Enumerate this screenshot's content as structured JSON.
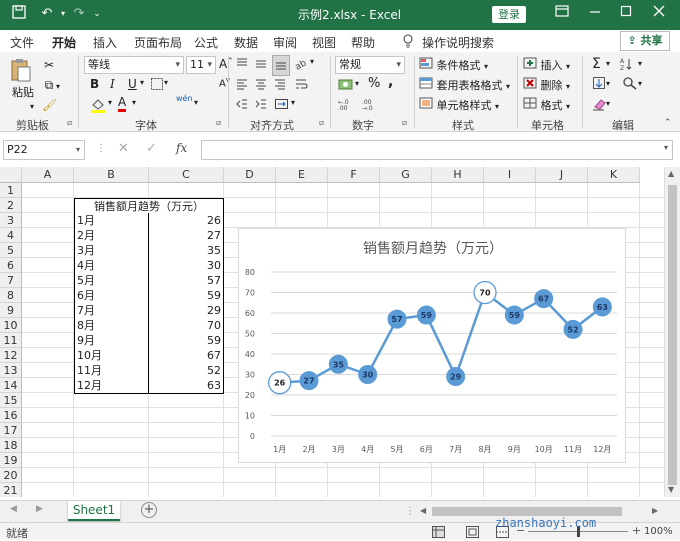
{
  "titlebar": {
    "filename": "示例2.xlsx",
    "sep": "-",
    "app": "Excel",
    "login": "登录",
    "undo": "↶",
    "redo": "↷"
  },
  "tabs": [
    "文件",
    "开始",
    "插入",
    "页面布局",
    "公式",
    "数据",
    "审阅",
    "视图",
    "帮助"
  ],
  "active_tab": "开始",
  "tell_me": "操作说明搜索",
  "share": "共享",
  "ribbon": {
    "clipboard": {
      "paste": "粘贴",
      "label": "剪贴板"
    },
    "font": {
      "name": "等线",
      "size": "11",
      "label": "字体",
      "bold": "B",
      "italic": "I",
      "underline": "U",
      "fontcolor": "A",
      "incA": "A",
      "decA": "A",
      "wen": "wén"
    },
    "alignment": {
      "label": "对齐方式"
    },
    "number": {
      "format": "常规",
      "label": "数字",
      "percent": "%",
      "comma": ","
    },
    "styles": {
      "cond": "条件格式",
      "table": "套用表格格式",
      "cell": "单元格样式",
      "label": "样式"
    },
    "cells": {
      "insert": "插入",
      "delete": "删除",
      "format": "格式",
      "label": "单元格"
    },
    "editing": {
      "label": "编辑",
      "sum": "Σ"
    }
  },
  "formula_bar": {
    "namebox": "P22",
    "fx": "fx",
    "value": ""
  },
  "columns": [
    "A",
    "B",
    "C",
    "D",
    "E",
    "F",
    "G",
    "H",
    "I",
    "J",
    "K"
  ],
  "rows": [
    "1",
    "2",
    "3",
    "4",
    "5",
    "6",
    "7",
    "8",
    "9",
    "10",
    "11",
    "12",
    "13",
    "14",
    "15",
    "16",
    "17",
    "18",
    "19",
    "20",
    "21",
    "22"
  ],
  "table": {
    "header": "销售额月趋势（万元）",
    "months": [
      "1月",
      "2月",
      "3月",
      "4月",
      "5月",
      "6月",
      "7月",
      "8月",
      "9月",
      "10月",
      "11月",
      "12月"
    ],
    "values": [
      "26",
      "27",
      "35",
      "30",
      "57",
      "59",
      "29",
      "70",
      "59",
      "67",
      "52",
      "63"
    ]
  },
  "chart_data": {
    "type": "line",
    "title": "销售额月趋势（万元）",
    "categories": [
      "1月",
      "2月",
      "3月",
      "4月",
      "5月",
      "6月",
      "7月",
      "8月",
      "9月",
      "10月",
      "11月",
      "12月"
    ],
    "values": [
      26,
      27,
      35,
      30,
      57,
      59,
      29,
      70,
      59,
      67,
      52,
      63
    ],
    "y_ticks": [
      "0",
      "10",
      "20",
      "30",
      "40",
      "50",
      "60",
      "70",
      "80"
    ],
    "ylim": [
      0,
      80
    ],
    "grid": true,
    "legend": "none",
    "highlight_points": [
      0,
      7
    ],
    "colors": {
      "line": "#5b9bd5",
      "marker": "#5b9bd5",
      "highlight_fill": "#ffffff",
      "grid": "#d9d9d9"
    }
  },
  "sheet_tabs": [
    "Sheet1"
  ],
  "status": {
    "ready": "就绪",
    "zoom": "100%",
    "watermark": "zhanshaoyi.com"
  },
  "colors": {
    "accent": "#217346",
    "ribbon": "#f3f3f3"
  }
}
